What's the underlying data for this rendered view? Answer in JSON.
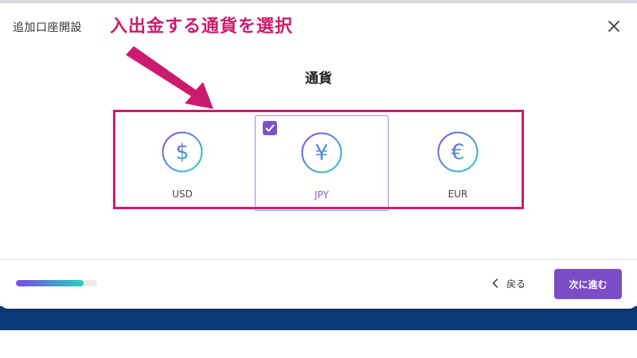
{
  "modal": {
    "title": "追加口座開設"
  },
  "annotation": {
    "text": "入出金する通貨を選択"
  },
  "section": {
    "title": "通貨"
  },
  "currencies": [
    {
      "code": "USD",
      "symbol": "$",
      "selected": false
    },
    {
      "code": "JPY",
      "symbol": "¥",
      "selected": true
    },
    {
      "code": "EUR",
      "symbol": "€",
      "selected": false
    }
  ],
  "footer": {
    "progress_percent": 83,
    "back_label": "戻る",
    "next_label": "次に進む"
  },
  "colors": {
    "accent": "#7a4cc6",
    "annotation": "#cc1b6e",
    "gradient_start": "#7b4be0",
    "gradient_end": "#23d2c3"
  }
}
